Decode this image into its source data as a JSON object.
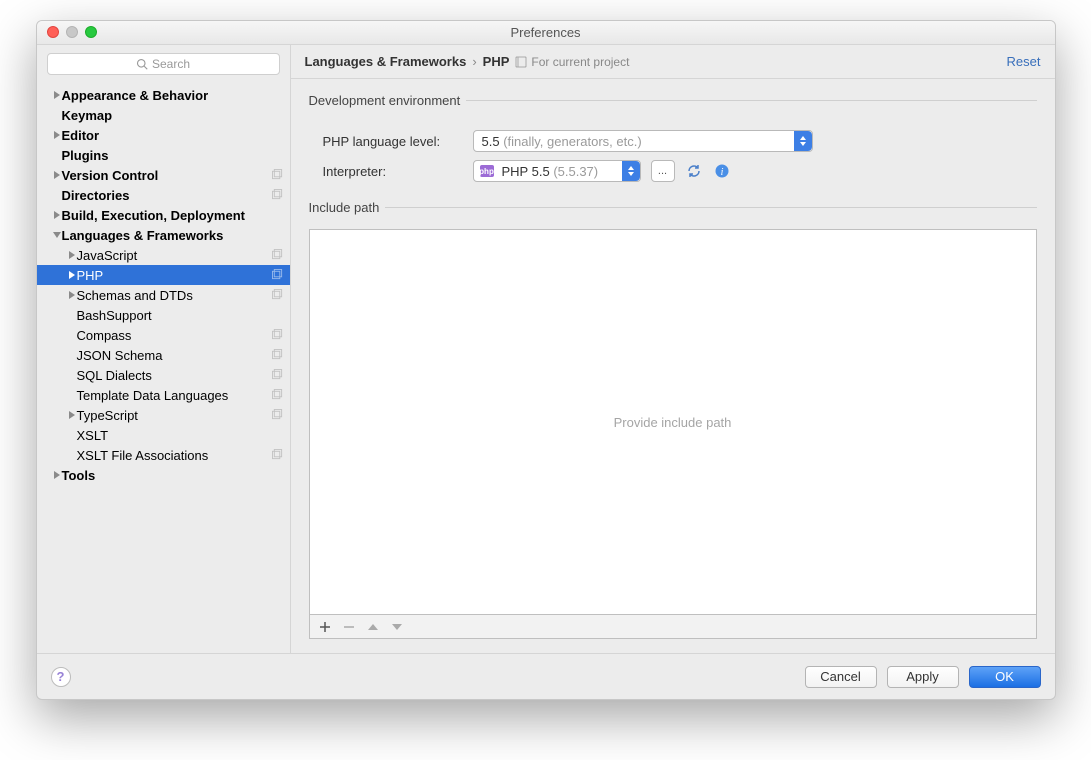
{
  "window": {
    "title": "Preferences"
  },
  "search": {
    "placeholder": "Search"
  },
  "tree": [
    {
      "label": "Appearance & Behavior",
      "depth": 0,
      "arrow": "right",
      "bold": true
    },
    {
      "label": "Keymap",
      "depth": 0,
      "arrow": "",
      "bold": true
    },
    {
      "label": "Editor",
      "depth": 0,
      "arrow": "right",
      "bold": true
    },
    {
      "label": "Plugins",
      "depth": 0,
      "arrow": "",
      "bold": true
    },
    {
      "label": "Version Control",
      "depth": 0,
      "arrow": "right",
      "bold": true,
      "badge": true
    },
    {
      "label": "Directories",
      "depth": 0,
      "arrow": "",
      "bold": true,
      "badge": true
    },
    {
      "label": "Build, Execution, Deployment",
      "depth": 0,
      "arrow": "right",
      "bold": true
    },
    {
      "label": "Languages & Frameworks",
      "depth": 0,
      "arrow": "down",
      "bold": true
    },
    {
      "label": "JavaScript",
      "depth": 1,
      "arrow": "right",
      "badge": true
    },
    {
      "label": "PHP",
      "depth": 1,
      "arrow": "right",
      "badge": true,
      "selected": true
    },
    {
      "label": "Schemas and DTDs",
      "depth": 1,
      "arrow": "right",
      "badge": true
    },
    {
      "label": "BashSupport",
      "depth": 1,
      "arrow": ""
    },
    {
      "label": "Compass",
      "depth": 1,
      "arrow": "",
      "badge": true
    },
    {
      "label": "JSON Schema",
      "depth": 1,
      "arrow": "",
      "badge": true
    },
    {
      "label": "SQL Dialects",
      "depth": 1,
      "arrow": "",
      "badge": true
    },
    {
      "label": "Template Data Languages",
      "depth": 1,
      "arrow": "",
      "badge": true
    },
    {
      "label": "TypeScript",
      "depth": 1,
      "arrow": "right",
      "badge": true
    },
    {
      "label": "XSLT",
      "depth": 1,
      "arrow": ""
    },
    {
      "label": "XSLT File Associations",
      "depth": 1,
      "arrow": "",
      "badge": true
    },
    {
      "label": "Tools",
      "depth": 0,
      "arrow": "right",
      "bold": true
    }
  ],
  "breadcrumb": {
    "parent": "Languages & Frameworks",
    "current": "PHP",
    "project_hint": "For current project",
    "reset": "Reset"
  },
  "dev_env": {
    "legend": "Development environment",
    "lang_label": "PHP language level:",
    "lang_value": "5.5",
    "lang_hint": "(finally, generators, etc.)",
    "interp_label": "Interpreter:",
    "interp_value": "PHP 5.5",
    "interp_hint": "(5.5.37)",
    "more_btn": "..."
  },
  "include": {
    "legend": "Include path",
    "placeholder": "Provide include path"
  },
  "footer": {
    "cancel": "Cancel",
    "apply": "Apply",
    "ok": "OK"
  }
}
